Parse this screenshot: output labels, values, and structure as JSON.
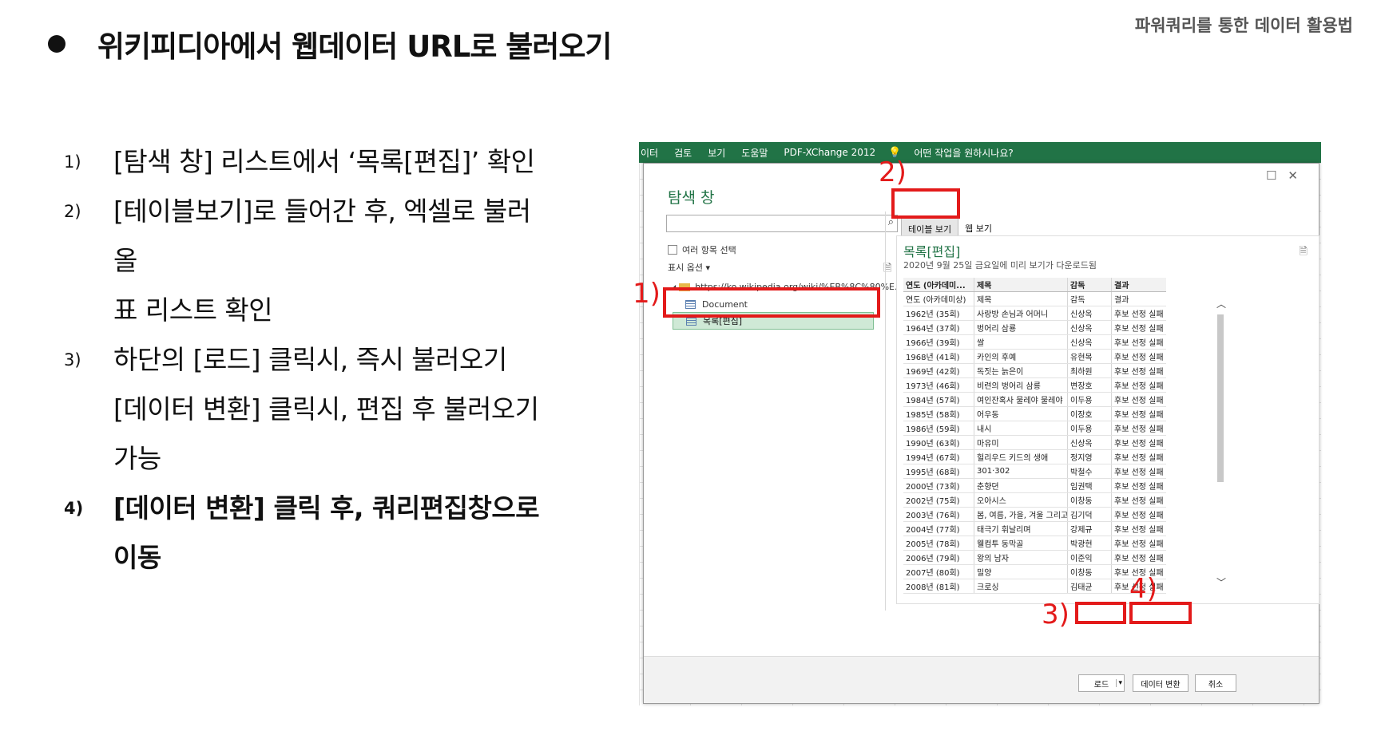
{
  "header_right": "파워쿼리를 통한 데이터 활용법",
  "title": "위키피디아에서 웹데이터 URL로 불러오기",
  "steps": [
    {
      "num": "1)",
      "lines": [
        "[탐색 창] 리스트에서 ‘목록[편집]’ 확인"
      ]
    },
    {
      "num": "2)",
      "lines": [
        "[테이블보기]로 들어간 후, 엑셀로 불러",
        "올",
        "표 리스트 확인"
      ]
    },
    {
      "num": "3)",
      "lines": [
        "하단의 [로드] 클릭시, 즉시 불러오기",
        "[데이터 변환] 클릭시, 편집 후 불러오기",
        "가능"
      ]
    },
    {
      "num": "4)",
      "lines": [
        "[데이터 변환] 클릭 후, 쿼리편집창으로",
        "이동"
      ]
    }
  ],
  "ribbon": {
    "items": [
      "이터",
      "검토",
      "보기",
      "도움말",
      "PDF-XChange 2012"
    ],
    "tell_me": "어떤 작업을 원하시나요?"
  },
  "dialog": {
    "nav_title": "탐색 창",
    "multi_select": "여러 항목 선택",
    "display_options": "표시 옵션",
    "tree_url": "https://ko.wikipedia.org/wiki/%EB%8C%80%E...",
    "tree_doc": "Document",
    "tree_selected": "목록[편집]",
    "tab_table": "테이블 보기",
    "tab_web": "웹 보기",
    "preview_title": "목록[편집]",
    "preview_sub": "2020년 9월 25일 금요일에 미리 보기가 다운로드됨",
    "columns": [
      "연도 (아카데미...",
      "제목",
      "감독",
      "결과"
    ],
    "rows": [
      [
        "연도 (아카데미상)",
        "제목",
        "감독",
        "결과"
      ],
      [
        "1962년 (35회)",
        "사랑방 손님과 어머니",
        "신상옥",
        "후보 선정 실패"
      ],
      [
        "1964년 (37회)",
        "벙어리 삼룡",
        "신상옥",
        "후보 선정 실패"
      ],
      [
        "1966년 (39회)",
        "쌀",
        "신상옥",
        "후보 선정 실패"
      ],
      [
        "1968년 (41회)",
        "카인의 후예",
        "유현목",
        "후보 선정 실패"
      ],
      [
        "1969년 (42회)",
        "독짓는 늙은이",
        "최하원",
        "후보 선정 실패"
      ],
      [
        "1973년 (46회)",
        "비련의 벙어리 삼룡",
        "변장호",
        "후보 선정 실패"
      ],
      [
        "1984년 (57회)",
        "여인잔혹사 물레야 물레야",
        "이두용",
        "후보 선정 실패"
      ],
      [
        "1985년 (58회)",
        "어우동",
        "이장호",
        "후보 선정 실패"
      ],
      [
        "1986년 (59회)",
        "내시",
        "이두용",
        "후보 선정 실패"
      ],
      [
        "1990년 (63회)",
        "마유미",
        "신상옥",
        "후보 선정 실패"
      ],
      [
        "1994년 (67회)",
        "헐리우드 키드의 생애",
        "정지영",
        "후보 선정 실패"
      ],
      [
        "1995년 (68회)",
        "301·302",
        "박철수",
        "후보 선정 실패"
      ],
      [
        "2000년 (73회)",
        "춘향뎐",
        "임권택",
        "후보 선정 실패"
      ],
      [
        "2002년 (75회)",
        "오아시스",
        "이창동",
        "후보 선정 실패"
      ],
      [
        "2003년 (76회)",
        "봄, 여름, 가을, 겨울 그리고 봄",
        "김기덕",
        "후보 선정 실패"
      ],
      [
        "2004년 (77회)",
        "태극기 휘날리며",
        "강제규",
        "후보 선정 실패"
      ],
      [
        "2005년 (78회)",
        "웰컴투 동막골",
        "박광현",
        "후보 선정 실패"
      ],
      [
        "2006년 (79회)",
        "왕의 남자",
        "이준익",
        "후보 선정 실패"
      ],
      [
        "2007년 (80회)",
        "밀양",
        "이창동",
        "후보 선정 실패"
      ],
      [
        "2008년 (81회)",
        "크로싱",
        "김태균",
        "후보 선정 실패"
      ]
    ],
    "load": "로드",
    "transform": "데이터 변환",
    "cancel": "취소"
  },
  "annotations": {
    "a1": "1)",
    "a2": "2)",
    "a3": "3)",
    "a4": "4)",
    "color": "#e31a1a"
  }
}
